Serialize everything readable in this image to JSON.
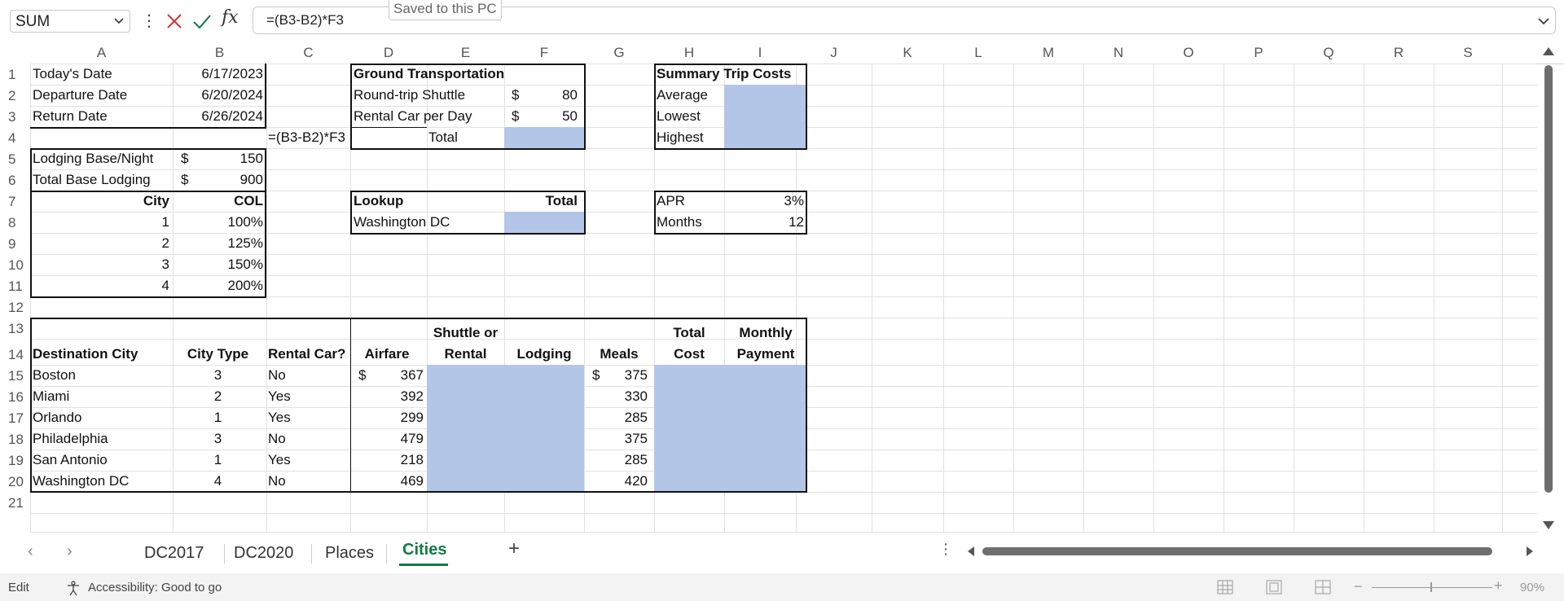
{
  "formula_bar": {
    "name_box": "SUM",
    "formula": "=(B3-B2)*F3",
    "saved_tooltip": "Saved to this PC",
    "fx_label": "fx"
  },
  "columns": [
    "A",
    "B",
    "C",
    "D",
    "E",
    "F",
    "G",
    "H",
    "I",
    "J",
    "K",
    "L",
    "M",
    "N",
    "O",
    "P",
    "Q",
    "R",
    "S"
  ],
  "rows": [
    "1",
    "2",
    "3",
    "4",
    "5",
    "6",
    "7",
    "8",
    "9",
    "10",
    "11",
    "12",
    "13",
    "14",
    "15",
    "16",
    "17",
    "18",
    "19",
    "20",
    "21"
  ],
  "cells": {
    "a1": "Today's Date",
    "b1": "6/17/2023",
    "a2": "Departure Date",
    "b2": "6/20/2024",
    "a3": "Return Date",
    "b3": "6/26/2024",
    "c4": "=(B3-B2)*F3",
    "a5": "Lodging Base/Night",
    "b5_sym": "$",
    "b5": "150",
    "a6": "Total Base Lodging",
    "b6_sym": "$",
    "b6": "900",
    "a7": "City",
    "b7": "COL",
    "a8": "1",
    "b8": "100%",
    "a9": "2",
    "b9": "125%",
    "a10": "3",
    "b10": "150%",
    "a11": "4",
    "b11": "200%",
    "d1": "Ground Transportation",
    "d2": "Round-trip Shuttle",
    "f2_sym": "$",
    "f2": "80",
    "d3": "Rental Car per Day",
    "f3_sym": "$",
    "f3": "50",
    "e4": "Total",
    "d7": "Lookup",
    "f7": "Total",
    "d8": "Washington DC",
    "h1": "Summary Trip Costs",
    "h2": "Average",
    "h3": "Lowest",
    "h4": "Highest",
    "h7": "APR",
    "i7": "3%",
    "h8": "Months",
    "i8": "12"
  },
  "table": {
    "headers": {
      "a": "Destination City",
      "b": "City Type",
      "c": "Rental Car?",
      "d": "Airfare",
      "e1": "Shuttle or",
      "e2": "Rental",
      "f": "Lodging",
      "g": "Meals",
      "h1": "Total",
      "h2": "Cost",
      "i1": "Monthly",
      "i2": "Payment"
    },
    "rows": [
      {
        "city": "Boston",
        "type": "3",
        "rental": "No",
        "air_sym": "$",
        "airfare": "367",
        "meals_sym": "$",
        "meals": "375"
      },
      {
        "city": "Miami",
        "type": "2",
        "rental": "Yes",
        "air_sym": "",
        "airfare": "392",
        "meals_sym": "",
        "meals": "330"
      },
      {
        "city": "Orlando",
        "type": "1",
        "rental": "Yes",
        "air_sym": "",
        "airfare": "299",
        "meals_sym": "",
        "meals": "285"
      },
      {
        "city": "Philadelphia",
        "type": "3",
        "rental": "No",
        "air_sym": "",
        "airfare": "479",
        "meals_sym": "",
        "meals": "375"
      },
      {
        "city": "San Antonio",
        "type": "1",
        "rental": "Yes",
        "air_sym": "",
        "airfare": "218",
        "meals_sym": "",
        "meals": "285"
      },
      {
        "city": "Washington DC",
        "type": "4",
        "rental": "No",
        "air_sym": "",
        "airfare": "469",
        "meals_sym": "",
        "meals": "420"
      }
    ]
  },
  "tabs": [
    "DC2017",
    "DC2020",
    "Places",
    "Cities"
  ],
  "active_tab": "Cities",
  "add_sheet": "+",
  "status": {
    "mode": "Edit",
    "accessibility": "Accessibility: Good to go",
    "zoom": "90%"
  },
  "colors": {
    "fill": "#b4c6e7",
    "active_tab": "#107c41"
  }
}
